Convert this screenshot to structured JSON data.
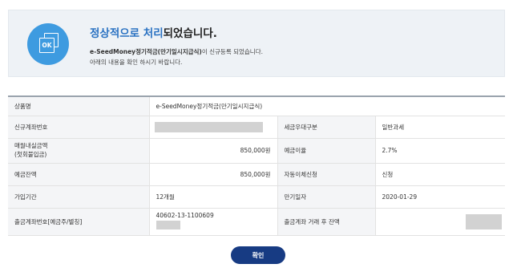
{
  "banner": {
    "badge_text": "OK",
    "title_highlight": "정상적으로 처리",
    "title_rest": "되었습니다.",
    "product_name": "e-SeedMoney정기적금(만기일시지급식)",
    "line1_suffix": "이 신규등록 되었습니다.",
    "line2": "아래의 내용을 확인 하시기 바랍니다."
  },
  "table": {
    "product_label": "상품명",
    "product_value": "e-SeedMoney정기적금(만기일시지급식)",
    "new_account_label": "신규계좌번호",
    "tax_label": "세금우대구분",
    "tax_value": "일반과세",
    "monthly_label_line1": "매월내실금액",
    "monthly_label_line2": "(첫회불입금)",
    "monthly_value": "850,000원",
    "rate_label": "예금이율",
    "rate_value": "2.7%",
    "balance_label": "예금잔액",
    "balance_value": "850,000원",
    "autotransfer_label": "자동이체신청",
    "autotransfer_value": "신청",
    "period_label": "가입기간",
    "period_value": "12개월",
    "maturity_label": "만기일자",
    "maturity_value": "2020-01-29",
    "withdraw_label": "출금계좌번호[예금주/별칭]",
    "withdraw_account": "40602-13-1100609",
    "withdraw_balance_label": "출금계좌 거래 후 잔액"
  },
  "confirm_label": "확인"
}
